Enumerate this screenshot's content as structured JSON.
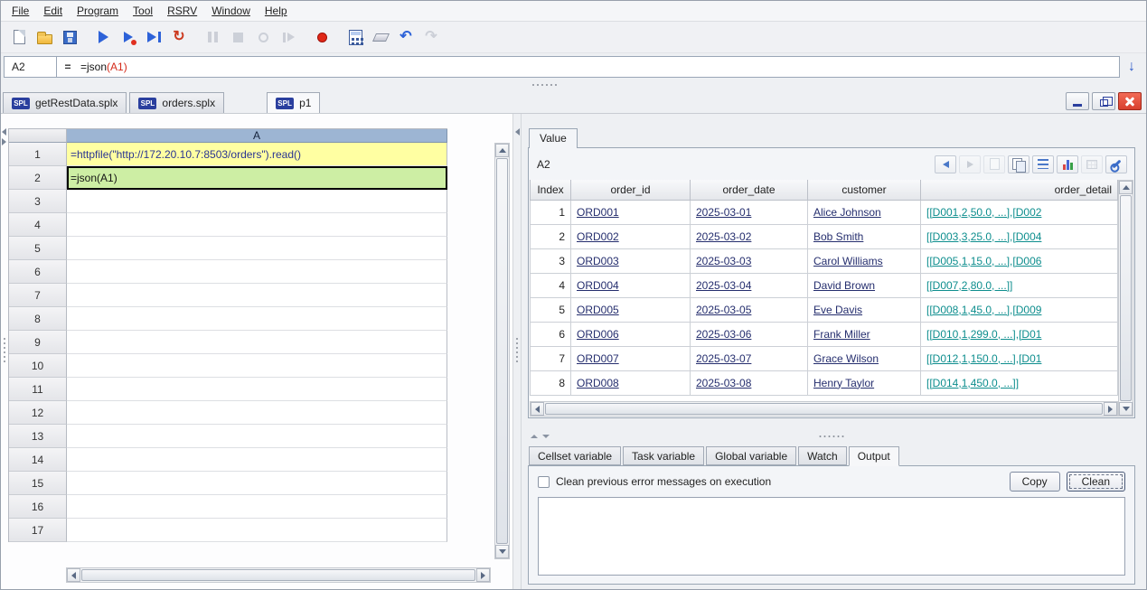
{
  "menubar": {
    "items": [
      "File",
      "Edit",
      "Program",
      "Tool",
      "RSRV",
      "Window",
      "Help"
    ]
  },
  "toolbar": {
    "icons": [
      "new-file",
      "open-file",
      "save",
      "run",
      "debug-run",
      "step-run",
      "reload",
      "pause",
      "stop",
      "step-over",
      "breakpoint",
      "record",
      "calculator",
      "clear-cells",
      "undo",
      "redo"
    ],
    "glyphs": {
      "reload": "↻",
      "undo": "↶",
      "redo": "↷"
    }
  },
  "formula_bar": {
    "cell_ref": "A2",
    "equals": "=",
    "formula_main": "=json",
    "formula_arg": "(A1)",
    "expand_glyph": "↓"
  },
  "tabs": [
    {
      "badge": "SPL",
      "label": "getRestData.splx"
    },
    {
      "badge": "SPL",
      "label": "orders.splx"
    },
    {
      "badge": "SPL",
      "label": "p1"
    }
  ],
  "grid": {
    "col_header": "A",
    "rows": [
      {
        "num": "1",
        "content": "=httpfile(\"http://172.20.10.7:8503/orders\").read()"
      },
      {
        "num": "2",
        "content": "=json(A1)"
      },
      {
        "num": "3",
        "content": ""
      },
      {
        "num": "4",
        "content": ""
      },
      {
        "num": "5",
        "content": ""
      },
      {
        "num": "6",
        "content": ""
      },
      {
        "num": "7",
        "content": ""
      },
      {
        "num": "8",
        "content": ""
      },
      {
        "num": "9",
        "content": ""
      },
      {
        "num": "10",
        "content": ""
      },
      {
        "num": "11",
        "content": ""
      },
      {
        "num": "12",
        "content": ""
      },
      {
        "num": "13",
        "content": ""
      },
      {
        "num": "14",
        "content": ""
      },
      {
        "num": "15",
        "content": ""
      },
      {
        "num": "16",
        "content": ""
      },
      {
        "num": "17",
        "content": ""
      }
    ]
  },
  "value_panel": {
    "tab_label": "Value",
    "cell_ref": "A2",
    "columns": [
      "Index",
      "order_id",
      "order_date",
      "customer",
      "order_detail"
    ],
    "rows": [
      {
        "index": "1",
        "order_id": "ORD001",
        "order_date": "2025-03-01",
        "customer": "Alice Johnson",
        "order_detail": "[[D001,2,50.0, ...],[D002"
      },
      {
        "index": "2",
        "order_id": "ORD002",
        "order_date": "2025-03-02",
        "customer": "Bob Smith",
        "order_detail": "[[D003,3,25.0, ...],[D004"
      },
      {
        "index": "3",
        "order_id": "ORD003",
        "order_date": "2025-03-03",
        "customer": "Carol Williams",
        "order_detail": "[[D005,1,15.0, ...],[D006"
      },
      {
        "index": "4",
        "order_id": "ORD004",
        "order_date": "2025-03-04",
        "customer": "David Brown",
        "order_detail": "[[D007,2,80.0, ...]]"
      },
      {
        "index": "5",
        "order_id": "ORD005",
        "order_date": "2025-03-05",
        "customer": "Eve Davis",
        "order_detail": "[[D008,1,45.0, ...],[D009"
      },
      {
        "index": "6",
        "order_id": "ORD006",
        "order_date": "2025-03-06",
        "customer": "Frank Miller",
        "order_detail": "[[D010,1,299.0, ...],[D01"
      },
      {
        "index": "7",
        "order_id": "ORD007",
        "order_date": "2025-03-07",
        "customer": "Grace Wilson",
        "order_detail": "[[D012,1,150.0, ...],[D01"
      },
      {
        "index": "8",
        "order_id": "ORD008",
        "order_date": "2025-03-08",
        "customer": "Henry Taylor",
        "order_detail": "[[D014,1,450.0, ...]]"
      }
    ]
  },
  "bottom_panel": {
    "tabs": [
      "Cellset variable",
      "Task variable",
      "Global variable",
      "Watch",
      "Output"
    ],
    "active_tab": "Output",
    "checkbox_label": "Clean previous error messages on execution",
    "copy_label": "Copy",
    "clean_label": "Clean"
  },
  "colors": {
    "cell_a1_bg": "#ffffa2",
    "cell_a2_bg": "#cdeea4",
    "formula_arg_red": "#d42a1a",
    "detail_teal": "#0e8e8e",
    "link_navy": "#252e6e",
    "column_header_blue": "#9db5d3",
    "spl_badge_blue": "#2a3f9e",
    "close_button_red": "#d8402e"
  }
}
